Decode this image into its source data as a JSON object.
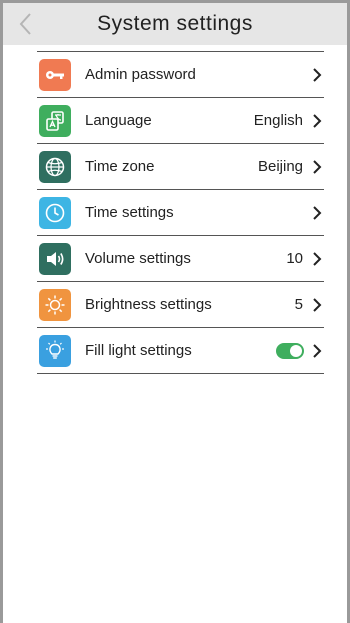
{
  "header": {
    "title": "System settings",
    "back_icon": "chevron-left-icon"
  },
  "colors": {
    "admin_password": "#f07a52",
    "language": "#3fae5e",
    "time_zone": "#2f6f60",
    "time_settings": "#3db5e4",
    "volume_settings": "#2f6f60",
    "brightness_settings": "#f0943f",
    "fill_light_settings": "#3aa0e0",
    "toggle_on": "#3fae5e"
  },
  "settings": {
    "admin_password": {
      "label": "Admin password",
      "icon": "key-icon"
    },
    "language": {
      "label": "Language",
      "value": "English",
      "icon": "translate-icon"
    },
    "time_zone": {
      "label": "Time zone",
      "value": "Beijing",
      "icon": "globe-icon"
    },
    "time_settings": {
      "label": "Time settings",
      "icon": "clock-icon"
    },
    "volume_settings": {
      "label": "Volume settings",
      "value": "10",
      "icon": "speaker-icon"
    },
    "brightness_settings": {
      "label": "Brightness settings",
      "value": "5",
      "icon": "sun-icon"
    },
    "fill_light_settings": {
      "label": "Fill light settings",
      "toggle_on": true,
      "icon": "lightbulb-icon"
    }
  }
}
